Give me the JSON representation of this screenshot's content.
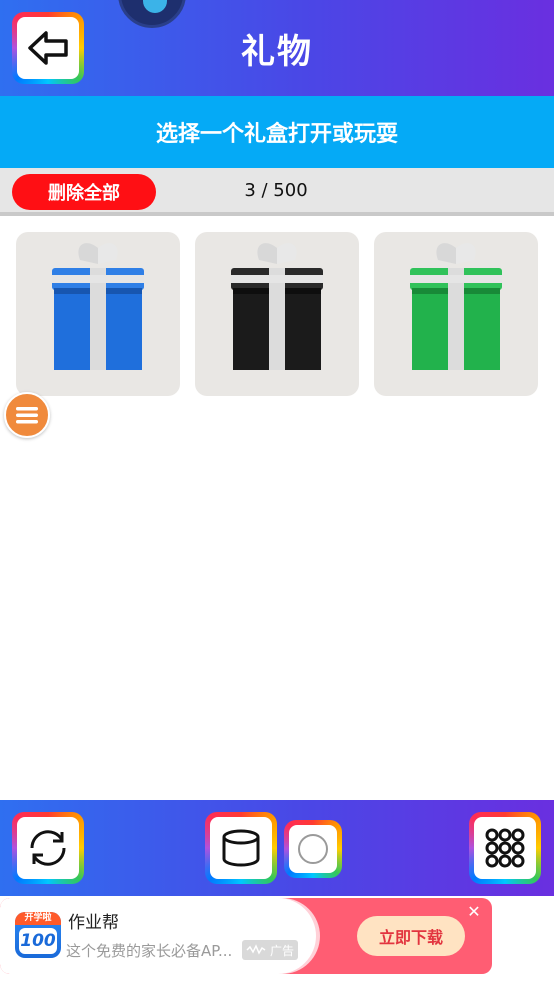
{
  "header": {
    "title": "礼物",
    "back_icon": "arrow-left-icon",
    "colors": {
      "gradient_start": "#2f6ff0",
      "gradient_end": "#6a2fe0"
    }
  },
  "instruction": {
    "text": "选择一个礼盒打开或玩耍",
    "background": "#05aaf6"
  },
  "controls": {
    "delete_all_label": "删除全部",
    "delete_color": "#ff0f14",
    "counter": "3 / 500"
  },
  "gifts": [
    {
      "name": "blue-gift-box",
      "color": "#1f6fdc"
    },
    {
      "name": "black-gift-box",
      "color": "#1b1b1b"
    },
    {
      "name": "green-gift-box",
      "color": "#22b24c"
    }
  ],
  "float_menu": {
    "icon": "hamburger-menu-icon",
    "color": "#f08a3c"
  },
  "bottom_toolbar": {
    "icons": [
      "refresh-icon",
      "database-icon",
      "circle-icon",
      "grid-icon"
    ]
  },
  "ad": {
    "logo_top_text": "开学啦",
    "logo_number": "100",
    "title": "作业帮",
    "description": "这个免费的家长必备AP...",
    "badge": "广告",
    "cta_label": "立即下载",
    "close_icon": "close-icon"
  }
}
